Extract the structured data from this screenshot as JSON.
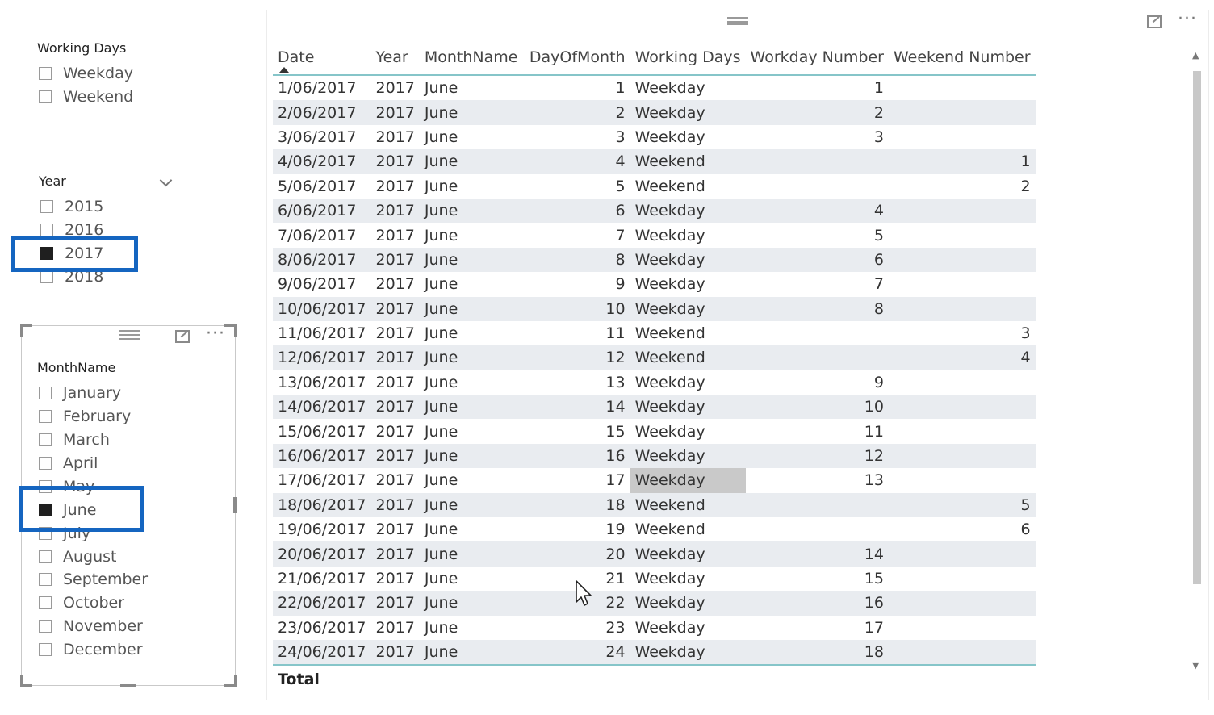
{
  "working_days_slicer": {
    "title": "Working Days",
    "items": [
      {
        "label": "Weekday",
        "checked": false
      },
      {
        "label": "Weekend",
        "checked": false
      }
    ]
  },
  "year_slicer": {
    "title": "Year",
    "items": [
      {
        "label": "2015",
        "checked": false
      },
      {
        "label": "2016",
        "checked": false
      },
      {
        "label": "2017",
        "checked": true
      },
      {
        "label": "2018",
        "checked": false
      }
    ]
  },
  "month_slicer": {
    "title": "MonthName",
    "items": [
      {
        "label": "January",
        "checked": false
      },
      {
        "label": "February",
        "checked": false
      },
      {
        "label": "March",
        "checked": false
      },
      {
        "label": "April",
        "checked": false
      },
      {
        "label": "May",
        "checked": false
      },
      {
        "label": "June",
        "checked": true
      },
      {
        "label": "July",
        "checked": false
      },
      {
        "label": "August",
        "checked": false
      },
      {
        "label": "September",
        "checked": false
      },
      {
        "label": "October",
        "checked": false
      },
      {
        "label": "November",
        "checked": false
      },
      {
        "label": "December",
        "checked": false
      }
    ]
  },
  "table": {
    "columns": [
      "Date",
      "Year",
      "MonthName",
      "DayOfMonth",
      "Working Days",
      "Workday Number",
      "Weekend Number"
    ],
    "sorted_column": "Date",
    "rows": [
      [
        "1/06/2017",
        "2017",
        "June",
        "1",
        "Weekday",
        "1",
        ""
      ],
      [
        "2/06/2017",
        "2017",
        "June",
        "2",
        "Weekday",
        "2",
        ""
      ],
      [
        "3/06/2017",
        "2017",
        "June",
        "3",
        "Weekday",
        "3",
        ""
      ],
      [
        "4/06/2017",
        "2017",
        "June",
        "4",
        "Weekend",
        "",
        "1"
      ],
      [
        "5/06/2017",
        "2017",
        "June",
        "5",
        "Weekend",
        "",
        "2"
      ],
      [
        "6/06/2017",
        "2017",
        "June",
        "6",
        "Weekday",
        "4",
        ""
      ],
      [
        "7/06/2017",
        "2017",
        "June",
        "7",
        "Weekday",
        "5",
        ""
      ],
      [
        "8/06/2017",
        "2017",
        "June",
        "8",
        "Weekday",
        "6",
        ""
      ],
      [
        "9/06/2017",
        "2017",
        "June",
        "9",
        "Weekday",
        "7",
        ""
      ],
      [
        "10/06/2017",
        "2017",
        "June",
        "10",
        "Weekday",
        "8",
        ""
      ],
      [
        "11/06/2017",
        "2017",
        "June",
        "11",
        "Weekend",
        "",
        "3"
      ],
      [
        "12/06/2017",
        "2017",
        "June",
        "12",
        "Weekend",
        "",
        "4"
      ],
      [
        "13/06/2017",
        "2017",
        "June",
        "13",
        "Weekday",
        "9",
        ""
      ],
      [
        "14/06/2017",
        "2017",
        "June",
        "14",
        "Weekday",
        "10",
        ""
      ],
      [
        "15/06/2017",
        "2017",
        "June",
        "15",
        "Weekday",
        "11",
        ""
      ],
      [
        "16/06/2017",
        "2017",
        "June",
        "16",
        "Weekday",
        "12",
        ""
      ],
      [
        "17/06/2017",
        "2017",
        "June",
        "17",
        "Weekday",
        "13",
        ""
      ],
      [
        "18/06/2017",
        "2017",
        "June",
        "18",
        "Weekend",
        "",
        "5"
      ],
      [
        "19/06/2017",
        "2017",
        "June",
        "19",
        "Weekend",
        "",
        "6"
      ],
      [
        "20/06/2017",
        "2017",
        "June",
        "20",
        "Weekday",
        "14",
        ""
      ],
      [
        "21/06/2017",
        "2017",
        "June",
        "21",
        "Weekday",
        "15",
        ""
      ],
      [
        "22/06/2017",
        "2017",
        "June",
        "22",
        "Weekday",
        "16",
        ""
      ],
      [
        "23/06/2017",
        "2017",
        "June",
        "23",
        "Weekday",
        "17",
        ""
      ],
      [
        "24/06/2017",
        "2017",
        "June",
        "24",
        "Weekday",
        "18",
        ""
      ]
    ],
    "selected_cell": {
      "row": 16,
      "col": 4
    },
    "total_label": "Total"
  },
  "colors": {
    "highlight": "#1565c0",
    "header_rule": "#86c5c9",
    "row_band": "#e9ecf0"
  }
}
